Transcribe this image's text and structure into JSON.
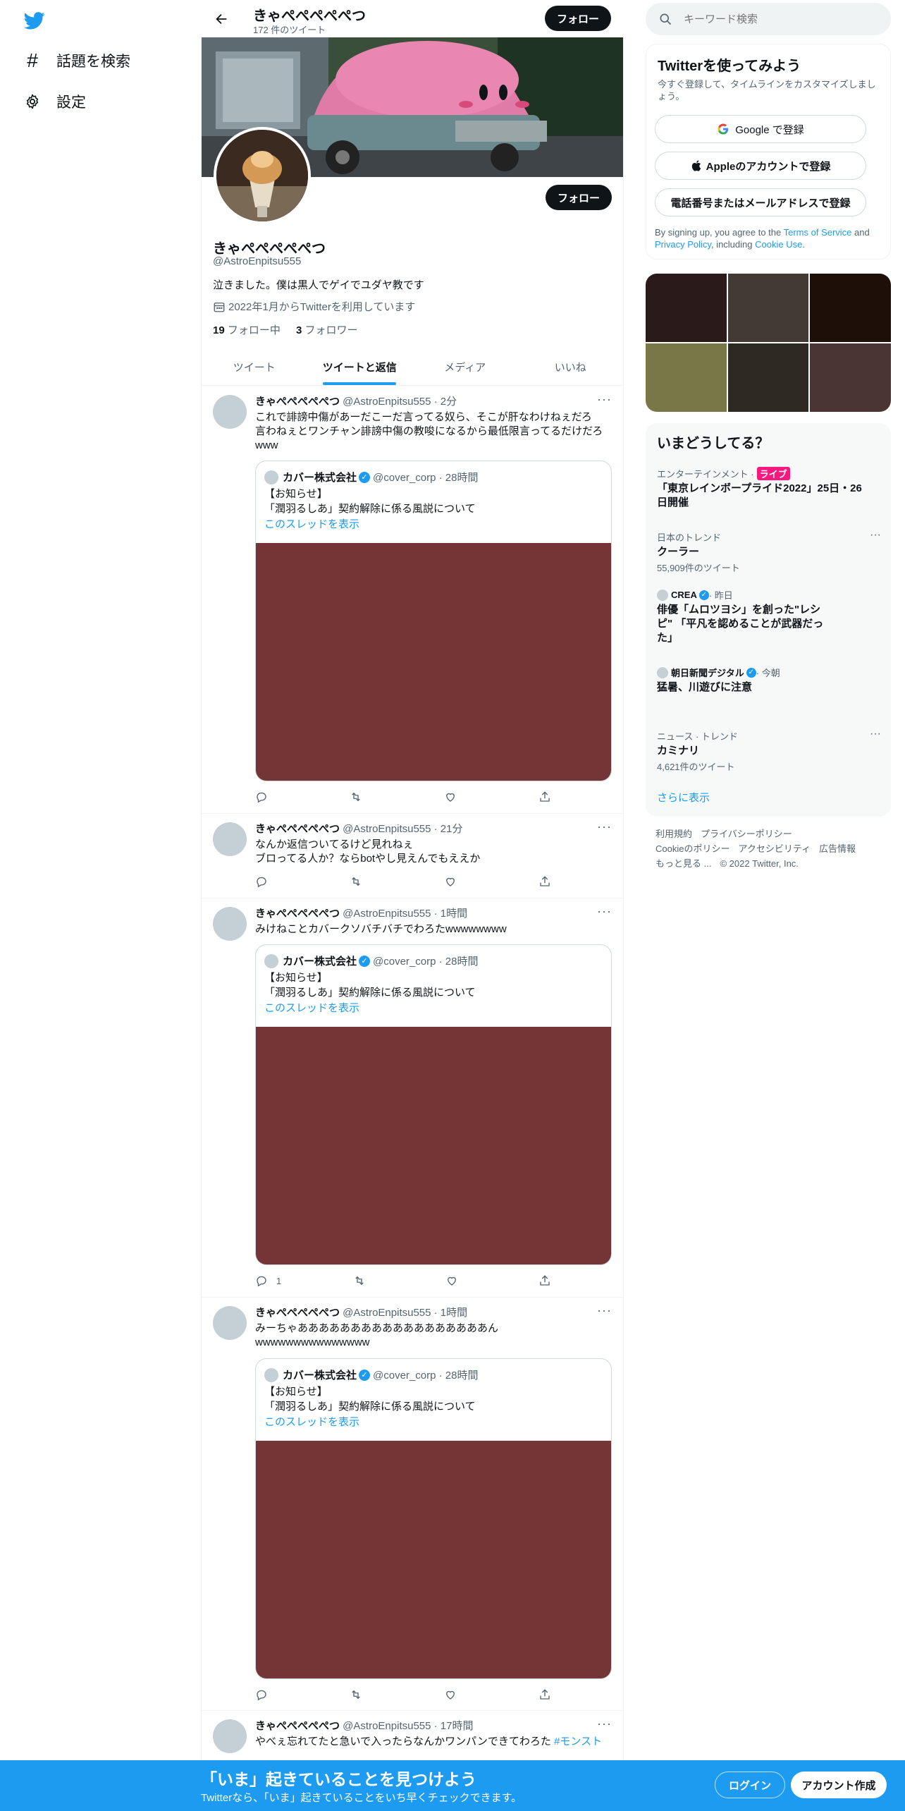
{
  "nav": {
    "explore_label": "話題を検索",
    "settings_label": "設定"
  },
  "header": {
    "name": "きゃぺぺぺぺぺつ",
    "tweet_count": "172 件のツイート",
    "follow_label": "フォロー"
  },
  "profile": {
    "name": "きゃぺぺぺぺぺつ",
    "handle": "@AstroEnpitsu555",
    "bio": "泣きました。僕は黒人でゲイでユダヤ教です",
    "joined": "2022年1月からTwitterを利用しています",
    "following_count": "19",
    "following_label": " フォロー中",
    "followers_count": "3",
    "followers_label": " フォロワー",
    "follow_label": "フォロー"
  },
  "tabs": [
    "ツイート",
    "ツイートと返信",
    "メディア",
    "いいね"
  ],
  "tweets": [
    {
      "name": "きゃぺぺぺぺぺつ",
      "handle_time": " @AstroEnpitsu555 · 2分",
      "text_lines": [
        "これで誹謗中傷があーだこーだ言ってる奴ら、そこが肝なわけねぇだろ",
        "言わねぇとワンチャン誹謗中傷の教唆になるから最低限言ってるだけだろ",
        "www"
      ],
      "quote": {
        "name": "カバー株式会社",
        "handle_time": "@cover_corp · 28時間",
        "line1": "【お知らせ】",
        "line2": "「潤羽るしあ」契約解除に係る風説について",
        "link": "このスレッドを表示"
      },
      "reply_count": "",
      "retweet_count": "",
      "like_count": ""
    },
    {
      "name": "きゃぺぺぺぺぺつ",
      "handle_time": " @AstroEnpitsu555 · 21分",
      "text_lines": [
        "なんか返信ついてるけど見れねぇ",
        "ブロってる人か？ならbotやし見えんでもええか"
      ],
      "reply_count": "",
      "retweet_count": "",
      "like_count": ""
    },
    {
      "name": "きゃぺぺぺぺぺつ",
      "handle_time": " @AstroEnpitsu555 · 1時間",
      "text_lines": [
        "みけねことカバークソバチバチでわろたwwwwwwww"
      ],
      "quote": {
        "name": "カバー株式会社",
        "handle_time": "@cover_corp · 28時間",
        "line1": "【お知らせ】",
        "line2": "「潤羽るしあ」契約解除に係る風説について",
        "link": "このスレッドを表示"
      },
      "reply_count": "1",
      "retweet_count": "",
      "like_count": ""
    },
    {
      "name": "きゃぺぺぺぺぺつ",
      "handle_time": " @AstroEnpitsu555 · 1時間",
      "text_lines": [
        "みーちゃああああああああああああああああああん",
        "wwwwwwwwwwwwwww"
      ],
      "quote": {
        "name": "カバー株式会社",
        "handle_time": "@cover_corp · 28時間",
        "line1": "【お知らせ】",
        "line2": "「潤羽るしあ」契約解除に係る風説について",
        "link": "このスレッドを表示"
      },
      "reply_count": "",
      "retweet_count": "",
      "like_count": ""
    },
    {
      "name": "きゃぺぺぺぺぺつ",
      "handle_time": " @AstroEnpitsu555 · 17時間",
      "text": "やべぇ忘れてたと急いで入ったらなんかワンパンできてわろた ",
      "hashtag": "#モンスト"
    }
  ],
  "search": {
    "placeholder": "キーワード検索"
  },
  "signup": {
    "title": "Twitterを使ってみよう",
    "subtitle": "今すぐ登録して、タイムラインをカスタマイズしましょう。",
    "google_label": "Google で登録",
    "apple_label": "Appleのアカウントで登録",
    "phone_label": "電話番号またはメールアドレスで登録",
    "legal_prefix": "By signing up, you agree to the ",
    "terms": "Terms of Service",
    "and": " and ",
    "privacy": "Privacy Policy",
    "including": ", including ",
    "cookie": "Cookie Use",
    "period": "."
  },
  "media_colors": [
    "#2a1a1a",
    "#423a33",
    "#1e1008",
    "#777747",
    "#2f2924",
    "#4a3532"
  ],
  "trends": {
    "title": "いまどうしてる？",
    "items": [
      {
        "meta": "エンターテインメント · ",
        "badge": "ライブ",
        "topic": "「東京レインボープライド2022」25日・26日開催"
      },
      {
        "meta": "日本のトレンド",
        "topic": "クーラー",
        "count": "55,909件のツイート"
      },
      {
        "source": "CREA",
        "time": " · 昨日",
        "topic": "俳優「ムロツヨシ」を創った\"レシピ\" 「平凡を認めることが武器だった」"
      },
      {
        "source": "朝日新聞デジタル",
        "time": " · 今朝",
        "topic": "猛暑、川遊びに注意"
      },
      {
        "meta": "ニュース · トレンド",
        "topic": "カミナリ",
        "count": "4,621件のツイート"
      }
    ],
    "show_more": "さらに表示"
  },
  "footer": {
    "links": [
      "利用規約",
      "プライバシーポリシー",
      "Cookieのポリシー",
      "アクセシビリティ",
      "広告情報",
      "もっと見る ..."
    ],
    "copyright": "© 2022 Twitter, Inc."
  },
  "bottom_bar": {
    "title": "「いま」起きていることを見つけよう",
    "subtitle": "Twitterなら、「いま」起きていることをいち早くチェックできます。",
    "login_label": "ログイン",
    "signup_label": "アカウント作成"
  },
  "colors": {
    "accent": "#1d9bf0",
    "quote_media": "#733535",
    "live_badge": "#f91880"
  }
}
